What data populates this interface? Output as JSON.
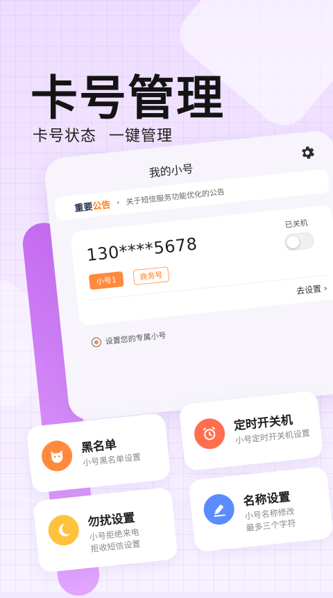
{
  "hero": {
    "title": "卡号管理",
    "subtitle_left": "卡号状态",
    "subtitle_right": "一键管理"
  },
  "phone": {
    "title": "我的小号",
    "settings_icon": "gear-icon",
    "notice": {
      "tag_prefix": "重要",
      "tag_highlight": "公告",
      "text": "关于短信服务功能优化的公告"
    },
    "card": {
      "number": "130****5678",
      "badge_primary": "小号1",
      "badge_secondary": "商务号",
      "power_status": "已关机",
      "toggle_on": false,
      "goto_settings": "去设置 ›"
    },
    "hint": "设置您的专属小号"
  },
  "features": [
    {
      "title": "黑名单",
      "subtitle": "小号黑名单设置",
      "icon": "cat-icon",
      "color": "#ff8a3d"
    },
    {
      "title": "定时开关机",
      "subtitle": "小号定时开关机设置",
      "icon": "alarm-clock-icon",
      "color": "#ff6f4f"
    },
    {
      "title": "勿扰设置",
      "subtitle": "小号拒绝来电\n拒收短信设置",
      "icon": "moon-icon",
      "color": "#ffc23d"
    },
    {
      "title": "名称设置",
      "subtitle": "小号名称修改\n最多三个字符",
      "icon": "edit-pen-icon",
      "color": "#5b8cff"
    }
  ],
  "colors": {
    "accent": "#ff8a3d",
    "purple": "#c56cf0"
  }
}
